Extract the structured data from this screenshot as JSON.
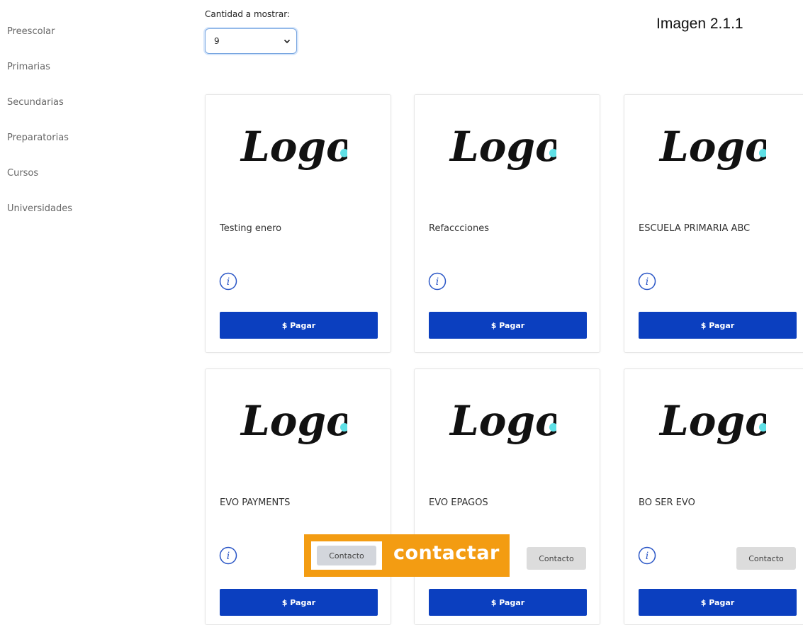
{
  "sidebar": {
    "items": [
      {
        "label": "Preescolar"
      },
      {
        "label": "Primarias"
      },
      {
        "label": "Secundarias"
      },
      {
        "label": "Preparatorias"
      },
      {
        "label": "Cursos"
      },
      {
        "label": "Universidades"
      }
    ]
  },
  "quantity": {
    "label": "Cantidad a mostrar:",
    "value": "9"
  },
  "caption": "Imagen 2.1.1",
  "cards": [
    {
      "title": "Testing enero",
      "pay_label": "$ Pagar",
      "logo_text": "Logo"
    },
    {
      "title": "Refaccciones",
      "pay_label": "$ Pagar",
      "logo_text": "Logo"
    },
    {
      "title": "ESCUELA PRIMARIA ABC",
      "pay_label": "$ Pagar",
      "logo_text": "Logo"
    },
    {
      "title": "EVO PAYMENTS",
      "pay_label": "$ Pagar",
      "logo_text": "Logo"
    },
    {
      "title": "EVO EPAGOS",
      "pay_label": "$ Pagar",
      "contact_label": "Contacto",
      "logo_text": "Logo"
    },
    {
      "title": "BO SER EVO",
      "pay_label": "$ Pagar",
      "contact_label": "Contacto",
      "logo_text": "Logo"
    }
  ],
  "callout": {
    "button_label": "Contacto",
    "text": "contactar"
  },
  "colors": {
    "pay_button": "#0b3fbf",
    "callout": "#f39c12",
    "logo_dot": "#5fe0e6",
    "info_icon": "#2a56c6"
  }
}
